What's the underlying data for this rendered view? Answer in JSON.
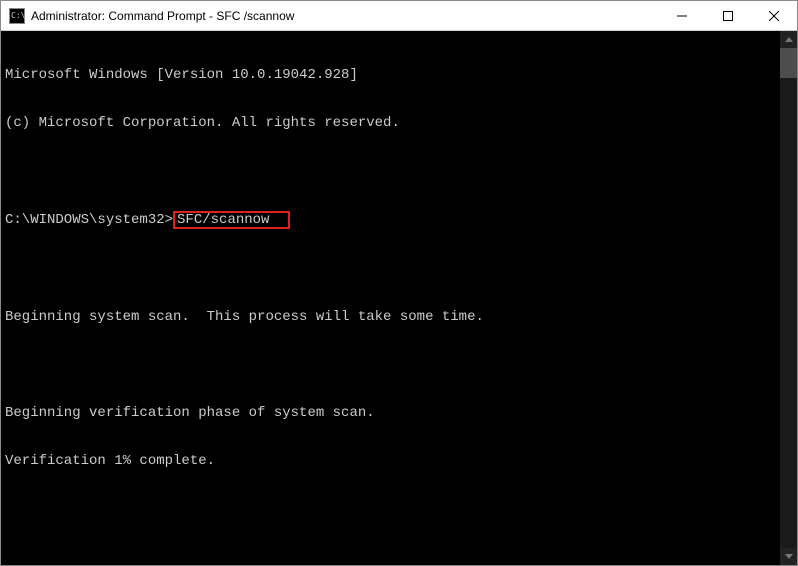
{
  "window": {
    "title": "Administrator: Command Prompt - SFC /scannow"
  },
  "terminal": {
    "line1": "Microsoft Windows [Version 10.0.19042.928]",
    "line2": "(c) Microsoft Corporation. All rights reserved.",
    "prompt_path": "C:\\WINDOWS\\system32>",
    "command": "SFC/scannow",
    "line5": "Beginning system scan.  This process will take some time.",
    "line7": "Beginning verification phase of system scan.",
    "line8": "Verification 1% complete."
  }
}
